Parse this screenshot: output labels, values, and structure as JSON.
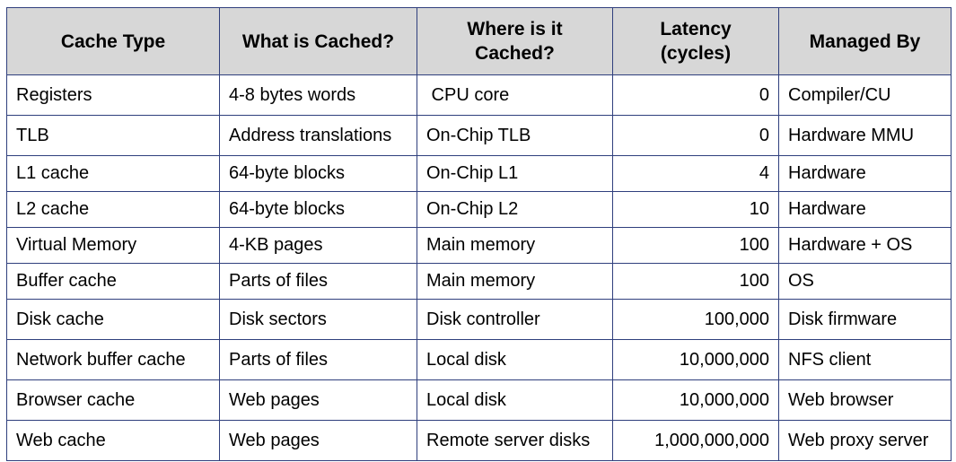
{
  "table": {
    "headers": [
      {
        "line1": "Cache Type",
        "line2": ""
      },
      {
        "line1": "What is Cached?",
        "line2": ""
      },
      {
        "line1": "Where is it",
        "line2": "Cached?"
      },
      {
        "line1": "Latency",
        "line2": "(cycles)"
      },
      {
        "line1": "Managed By",
        "line2": ""
      }
    ],
    "rows": [
      [
        "Registers",
        "4-8 bytes words",
        " CPU core",
        "0",
        "Compiler/CU"
      ],
      [
        "TLB",
        "Address translations",
        "On-Chip TLB",
        "0",
        "Hardware MMU"
      ],
      [
        "L1 cache",
        "64-byte blocks",
        "On-Chip L1",
        "4",
        "Hardware"
      ],
      [
        "L2 cache",
        "64-byte blocks",
        "On-Chip L2",
        "10",
        "Hardware"
      ],
      [
        "Virtual Memory",
        "4-KB pages",
        "Main memory",
        "100",
        "Hardware + OS"
      ],
      [
        "Buffer cache",
        "Parts of files",
        "Main memory",
        "100",
        "OS"
      ],
      [
        "Disk cache",
        "Disk sectors",
        "Disk controller",
        "100,000",
        "Disk firmware"
      ],
      [
        "Network buffer cache",
        "Parts of files",
        "Local disk",
        "10,000,000",
        "NFS client"
      ],
      [
        "Browser cache",
        "Web pages",
        "Local disk",
        "10,000,000",
        "Web browser"
      ],
      [
        "Web cache",
        "Web pages",
        "Remote server disks",
        "1,000,000,000",
        "Web proxy server"
      ]
    ]
  },
  "colors": {
    "header_bg": "#d7d7d7",
    "border": "#2f3f7d",
    "text": "#000000"
  }
}
